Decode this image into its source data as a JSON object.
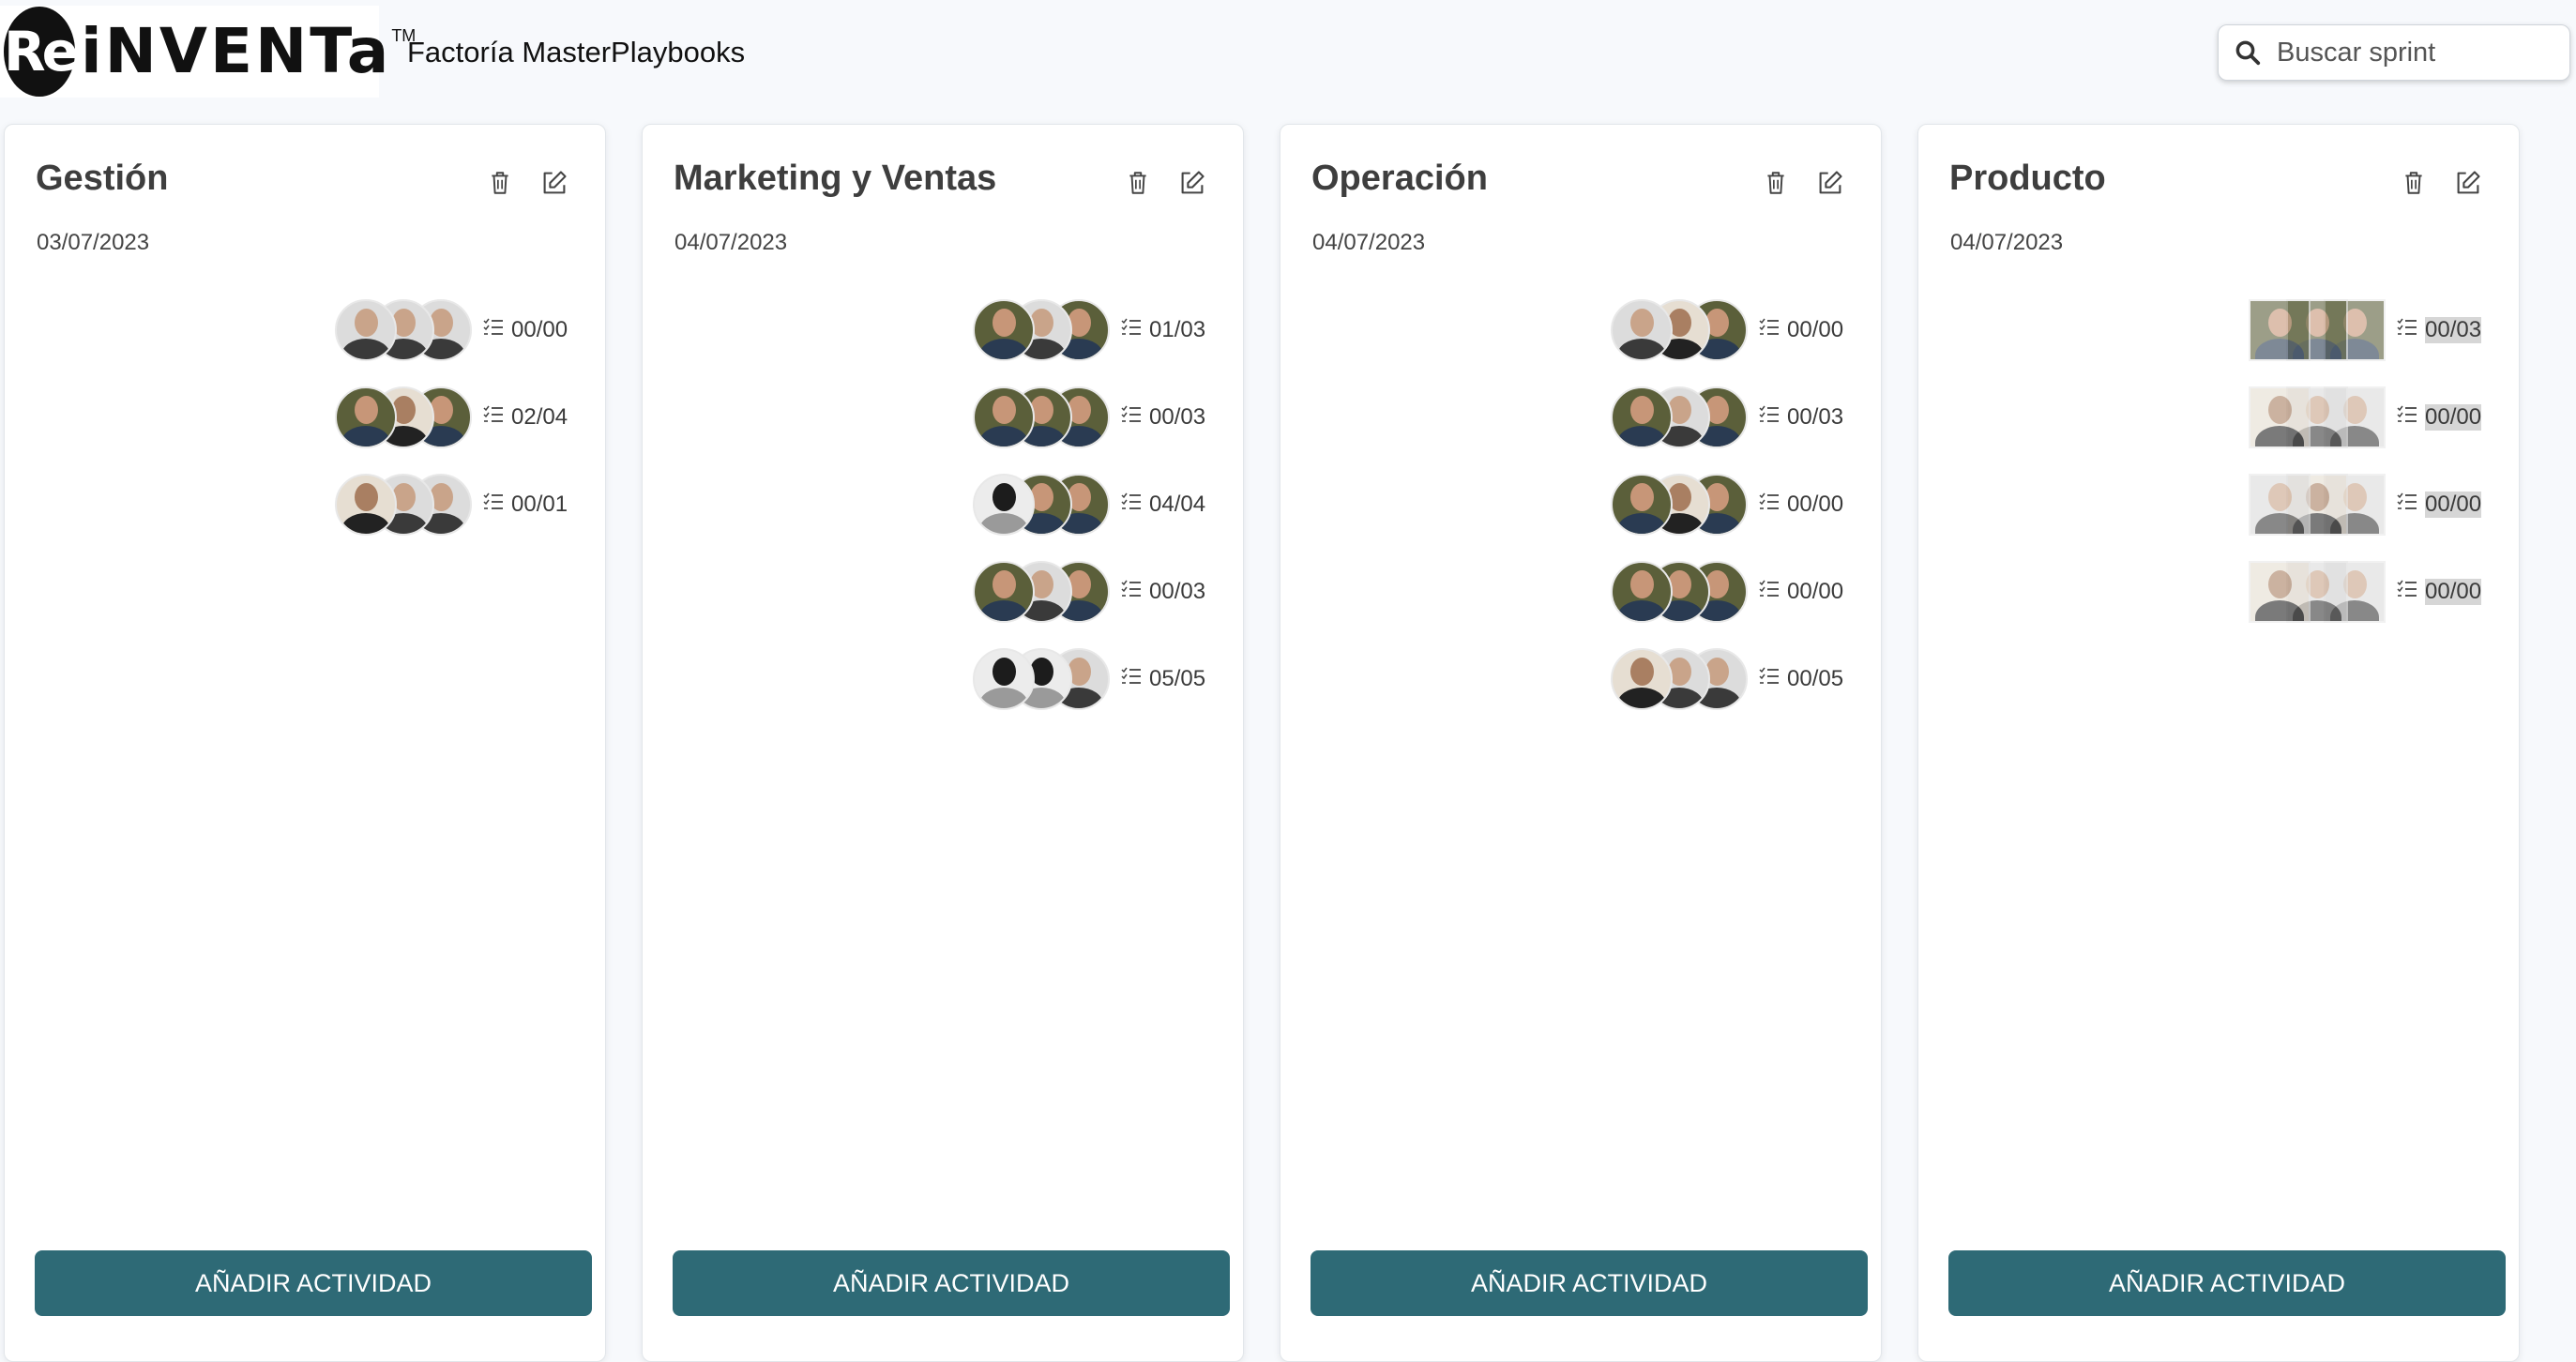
{
  "brand": {
    "mark": "Re",
    "word": "iNVENTa",
    "tm": "TM"
  },
  "app_title": "Factoría MasterPlaybooks",
  "search": {
    "placeholder": "Buscar sprint",
    "icon": "search-icon"
  },
  "colors": {
    "primary_button": "#2e6a76",
    "card_bg": "#ffffff",
    "page_bg": "#f7f9fc"
  },
  "columns": [
    {
      "title": "Gestión",
      "date": "03/07/2023",
      "button": "AÑADIR ACTIVIDAD",
      "dimmed": false,
      "rows": [
        {
          "count": "00/00",
          "avatars": [
            "woman-light",
            "woman-light",
            "woman-light"
          ]
        },
        {
          "count": "02/04",
          "avatars": [
            "man-dark",
            "woman-dark",
            "man-dark"
          ]
        },
        {
          "count": "00/01",
          "avatars": [
            "woman-dark",
            "woman-light",
            "woman-light"
          ]
        }
      ]
    },
    {
      "title": "Marketing y Ventas",
      "date": "04/07/2023",
      "button": "AÑADIR ACTIVIDAD",
      "dimmed": false,
      "rows": [
        {
          "count": "01/03",
          "avatars": [
            "man-dark",
            "woman-light",
            "man-dark"
          ]
        },
        {
          "count": "00/03",
          "avatars": [
            "man-dark",
            "man-dark",
            "man-dark"
          ]
        },
        {
          "count": "04/04",
          "avatars": [
            "bw",
            "man-dark",
            "man-dark"
          ]
        },
        {
          "count": "00/03",
          "avatars": [
            "man-dark",
            "woman-light",
            "man-dark"
          ]
        },
        {
          "count": "05/05",
          "avatars": [
            "bw",
            "bw",
            "woman-light"
          ]
        }
      ]
    },
    {
      "title": "Operación",
      "date": "04/07/2023",
      "button": "AÑADIR ACTIVIDAD",
      "dimmed": false,
      "rows": [
        {
          "count": "00/00",
          "avatars": [
            "woman-light",
            "woman-dark",
            "man-dark"
          ]
        },
        {
          "count": "00/03",
          "avatars": [
            "man-dark",
            "woman-light",
            "man-dark"
          ]
        },
        {
          "count": "00/00",
          "avatars": [
            "man-dark",
            "woman-dark",
            "man-dark"
          ]
        },
        {
          "count": "00/00",
          "avatars": [
            "man-dark",
            "man-dark",
            "man-dark"
          ]
        },
        {
          "count": "00/05",
          "avatars": [
            "woman-dark",
            "woman-light",
            "woman-light"
          ]
        }
      ]
    },
    {
      "title": "Producto",
      "date": "04/07/2023",
      "button": "AÑADIR ACTIVIDAD",
      "dimmed": true,
      "rows": [
        {
          "count": "00/03",
          "avatars": [
            "man-dark",
            "man-dark",
            "man-dark"
          ]
        },
        {
          "count": "00/00",
          "avatars": [
            "woman-dark",
            "woman-light",
            "woman-light"
          ]
        },
        {
          "count": "00/00",
          "avatars": [
            "woman-light",
            "woman-dark",
            "woman-light"
          ]
        },
        {
          "count": "00/00",
          "avatars": [
            "woman-dark",
            "woman-light",
            "woman-light"
          ]
        }
      ]
    }
  ]
}
